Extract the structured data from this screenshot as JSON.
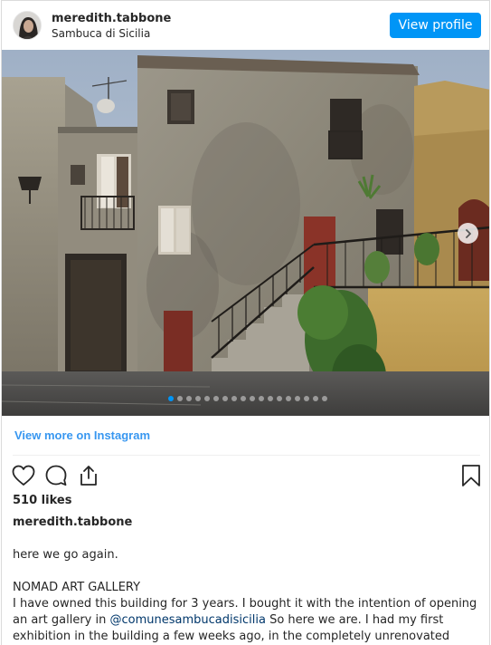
{
  "post": {
    "username": "meredith.tabbone",
    "location": "Sambuca di Sicilia",
    "view_profile_label": "View profile",
    "view_more_label": "View more on Instagram",
    "likes": "510 likes",
    "caption_user": "meredith.tabbone",
    "caption_line1": "here we go again.",
    "caption_heading": "NOMAD ART GALLERY",
    "caption_body_start": "I have owned this building for 3 years. I bought it with the intention of opening an art gallery in ",
    "caption_mention": "@comunesambucadisicilia",
    "caption_body_end": " So here we are. I had my first exhibition in the building a few weeks ago, in the completely unrenovated space. And now we will",
    "carousel_total": 18,
    "carousel_active": 1
  },
  "colors": {
    "button_blue": "#0095f6",
    "link_blue": "#3897f0",
    "mention_blue": "#00376b"
  },
  "icons": [
    "heart-icon",
    "comment-icon",
    "share-icon",
    "bookmark-icon",
    "chevron-right-icon"
  ]
}
